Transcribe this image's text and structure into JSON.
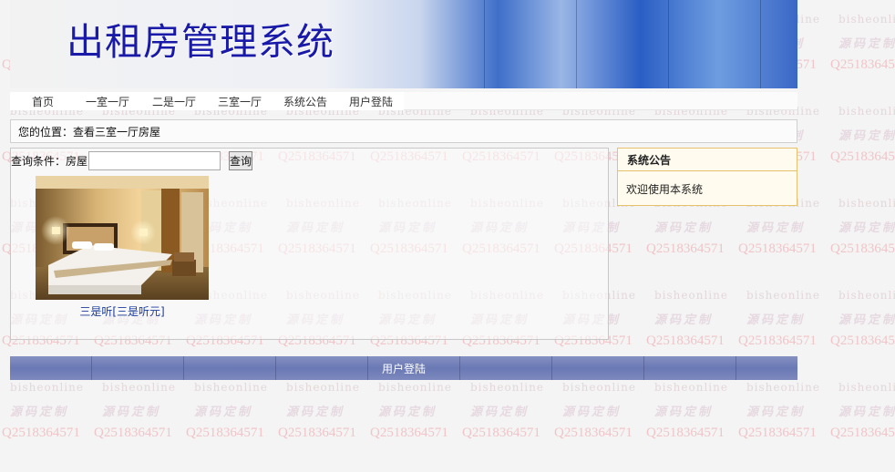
{
  "header": {
    "site_title": "出租房管理系统"
  },
  "nav": {
    "items": [
      {
        "label": "首页"
      },
      {
        "label": "一室一厅"
      },
      {
        "label": "二是一厅"
      },
      {
        "label": "三室一厅"
      },
      {
        "label": "系统公告"
      },
      {
        "label": "用户登陆"
      }
    ]
  },
  "breadcrumb": {
    "text": "您的位置：查看三室一厅房屋"
  },
  "search": {
    "label": "查询条件：房屋",
    "value": "",
    "button_label": "查询"
  },
  "listing": {
    "items": [
      {
        "caption": "三是听[三是听元]"
      }
    ]
  },
  "notice": {
    "title": "系统公告",
    "content": "欢迎使用本系统"
  },
  "footer": {
    "label": "用户登陆"
  },
  "watermark": {
    "site": "bisheonline",
    "tag": "源码定制",
    "qq": "Q2518364571"
  },
  "colors": {
    "title_blue": "#1a1aa8",
    "notice_border": "#e5c26b",
    "footer_bar": "#6a78b5"
  }
}
